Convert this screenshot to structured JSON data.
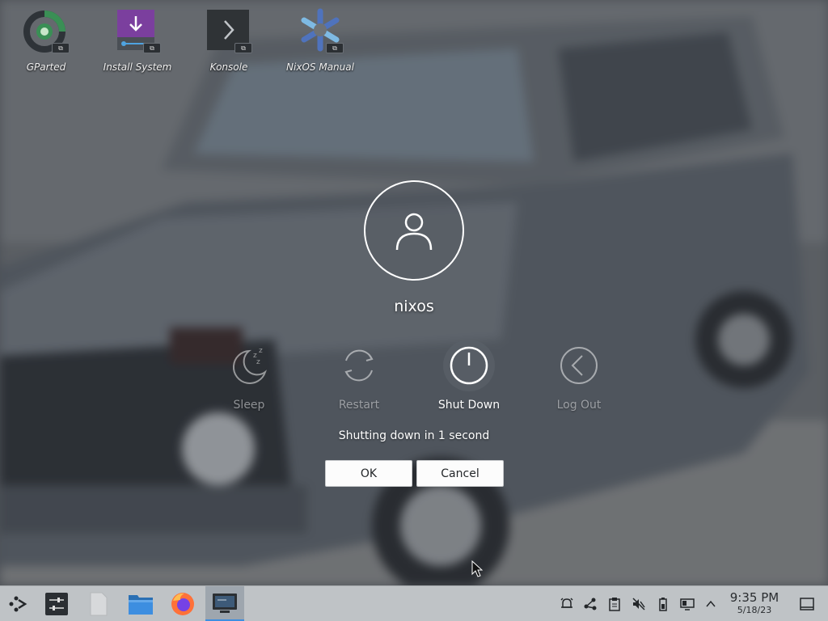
{
  "desktop": {
    "icons": [
      {
        "label": "GParted",
        "icon": "gparted-icon"
      },
      {
        "label": "Install System",
        "icon": "install-system-icon"
      },
      {
        "label": "Konsole",
        "icon": "konsole-icon"
      },
      {
        "label": "NixOS Manual",
        "icon": "nixos-snowflake-icon"
      }
    ],
    "link_badge": "⧉"
  },
  "logout_dialog": {
    "username": "nixos",
    "actions": [
      {
        "label": "Sleep",
        "icon": "sleep-moon-icon",
        "selected": false
      },
      {
        "label": "Restart",
        "icon": "restart-icon",
        "selected": false
      },
      {
        "label": "Shut Down",
        "icon": "power-icon",
        "selected": true
      },
      {
        "label": "Log Out",
        "icon": "log-out-arrow-icon",
        "selected": false
      }
    ],
    "countdown_text": "Shutting down in 1 second",
    "ok_label": "OK",
    "cancel_label": "Cancel"
  },
  "taskbar": {
    "launchers": [
      "application-launcher-icon",
      "system-settings-icon",
      "document-icon",
      "dolphin-folder-icon",
      "firefox-icon",
      "konsole-window-icon"
    ],
    "tray": [
      "notifications-icon",
      "network-share-icon",
      "clipboard-icon",
      "volume-muted-icon",
      "battery-icon",
      "display-icon",
      "expand-tray-chevron-icon"
    ],
    "clock": {
      "time": "9:35 PM",
      "date": "5/18/23"
    }
  },
  "colors": {
    "accent": "#3d8ee0",
    "taskbar_bg": "#bfc3c6",
    "button_bg": "#fcfcfc",
    "install_purple": "#7b3f9e",
    "gparted_green": "#3a8f55",
    "nixos_blue": "#4f73bd"
  }
}
